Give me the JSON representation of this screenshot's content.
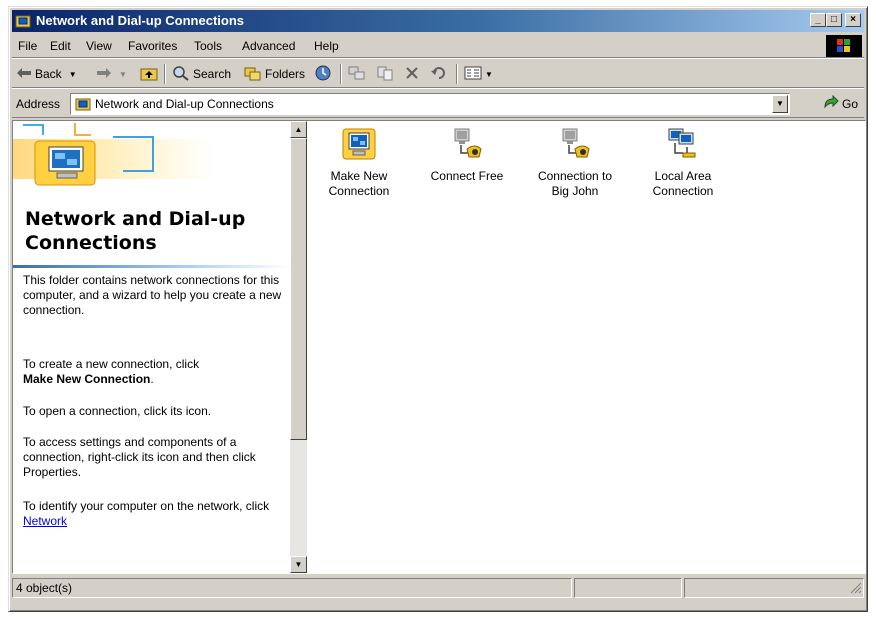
{
  "window": {
    "title": "Network and Dial-up Connections",
    "controls": {
      "minimize": "_",
      "maximize": "□",
      "close": "×"
    }
  },
  "menu": [
    "File",
    "Edit",
    "View",
    "Favorites",
    "Tools",
    "Advanced",
    "Help"
  ],
  "toolbar": {
    "back": "Back",
    "search": "Search",
    "folders": "Folders"
  },
  "address": {
    "label": "Address",
    "value": "Network and Dial-up Connections",
    "go": "Go"
  },
  "left_pane": {
    "heading": "Network and Dial-up Connections",
    "p1": "This folder contains network connections for this computer, and a wizard to help you create a new connection.",
    "p2_prefix": "To create a new connection, click",
    "p2_bold": "Make New Connection",
    "p2_suffix": ".",
    "p3": "To open a connection, click its icon.",
    "p4": "To access settings and components of a connection, right-click its icon and then click Properties.",
    "p5_prefix": "To identify your computer on the network, click",
    "p5_link": "Network"
  },
  "items": [
    {
      "line1": "Make New",
      "line2": "Connection",
      "icon": "make-new-connection-icon"
    },
    {
      "line1": "Connect Free",
      "line2": "",
      "icon": "dialup-connection-icon"
    },
    {
      "line1": "Connection to",
      "line2": "Big John",
      "icon": "dialup-connection-icon"
    },
    {
      "line1": "Local Area",
      "line2": "Connection",
      "icon": "lan-connection-icon"
    }
  ],
  "status": {
    "objects": "4 object(s)"
  }
}
